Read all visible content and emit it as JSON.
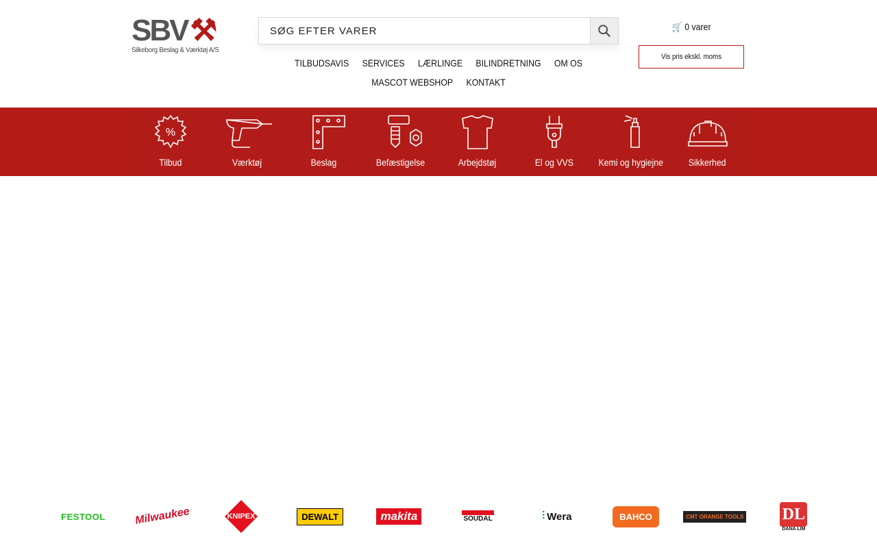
{
  "logo": {
    "text": "SBV",
    "subtitle": "Silkeborg Beslag & Værktøj A/S"
  },
  "search": {
    "placeholder": "SØG EFTER VARER"
  },
  "nav": {
    "row1": [
      "TILBUDSAVIS",
      "SERVICES",
      "LÆRLINGE",
      "BILINDRETNING",
      "OM OS"
    ],
    "row2": [
      "MASCOT WEBSHOP",
      "KONTAKT"
    ]
  },
  "cart": {
    "label": "0 varer"
  },
  "vat_toggle": {
    "label": "Vis pris ekskl. moms"
  },
  "categories": [
    {
      "label": "Tilbud",
      "icon": "discount-badge-icon"
    },
    {
      "label": "Værktøj",
      "icon": "drill-icon"
    },
    {
      "label": "Beslag",
      "icon": "bracket-icon"
    },
    {
      "label": "Befæstigelse",
      "icon": "screw-nut-icon"
    },
    {
      "label": "Arbejdstøj",
      "icon": "tshirt-icon"
    },
    {
      "label": "El og VVS",
      "icon": "plug-icon"
    },
    {
      "label": "Kemi og hygiejne",
      "icon": "spray-icon"
    },
    {
      "label": "Sikkerhed",
      "icon": "hardhat-icon"
    }
  ],
  "brands": [
    "FESTOOL",
    "Milwaukee",
    "KNIPEX",
    "DEWALT",
    "makita",
    "SOUDAL",
    "Wera",
    "BAHCO",
    "CMT ORANGE TOOLS",
    "DANA LIM"
  ],
  "colors": {
    "accent": "#b31b17"
  }
}
